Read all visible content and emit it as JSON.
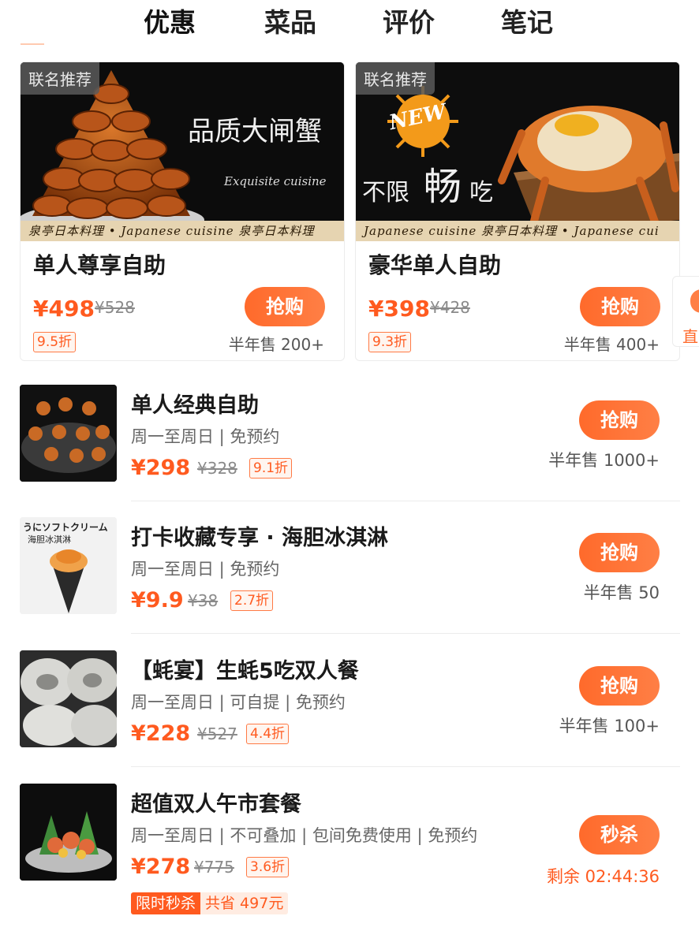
{
  "tabs": [
    {
      "label": "优惠"
    },
    {
      "label": "菜品"
    },
    {
      "label": "评价"
    },
    {
      "label": "笔记"
    }
  ],
  "featured": [
    {
      "badge": "联名推荐",
      "slogan": "品质大闸蟹",
      "slogan_en": "Exquisite cuisine",
      "strip": "泉亭日本料理 • Japanese cuisine  泉亭日本料理",
      "title": "单人尊享自助",
      "price": "¥498",
      "orig_price": "¥528",
      "discount": "9.5折",
      "buy": "抢购",
      "sold": "半年售 200+"
    },
    {
      "badge": "联名推荐",
      "new_label": "NEW",
      "slogan_a": "不限",
      "slogan_b": "畅",
      "slogan_c": "吃",
      "strip": "Japanese cuisine  泉亭日本料理 • Japanese cui",
      "title": "豪华单人自助",
      "price": "¥398",
      "orig_price": "¥428",
      "discount": "9.3折",
      "buy": "抢购",
      "sold": "半年售 400+"
    }
  ],
  "peek": {
    "label": "直"
  },
  "items": [
    {
      "title": "单人经典自助",
      "sub": "周一至周日 | 免预约",
      "price": "¥298",
      "orig_price": "¥328",
      "discount": "9.1折",
      "button": "抢购",
      "sold": "半年售 1000+"
    },
    {
      "title": "打卡收藏专享 · 海胆冰淇淋",
      "thumb_text_1": "うにソフトクリーム",
      "thumb_text_2": "海胆冰淇淋",
      "sub": "周一至周日 | 免预约",
      "price": "¥9.9",
      "orig_price": "¥38",
      "discount": "2.7折",
      "button": "抢购",
      "sold": "半年售 50"
    },
    {
      "title": "【蚝宴】生蚝5吃双人餐",
      "sub": "周一至周日 | 可自提 | 免预约",
      "price": "¥228",
      "orig_price": "¥527",
      "discount": "4.4折",
      "button": "抢购",
      "sold": "半年售 100+"
    },
    {
      "title": "超值双人午市套餐",
      "sub": "周一至周日 | 不可叠加 | 包间免费使用 | 免预约",
      "price": "¥278",
      "orig_price": "¥775",
      "discount": "3.6折",
      "button": "秒杀",
      "countdown": "剩余 02:44:36",
      "flash_a": "限时秒杀",
      "flash_b": "共省 497元"
    }
  ],
  "colors": {
    "accent": "#ff5a1f",
    "button": "#ff6a2b",
    "muted": "#8a8a8a"
  }
}
